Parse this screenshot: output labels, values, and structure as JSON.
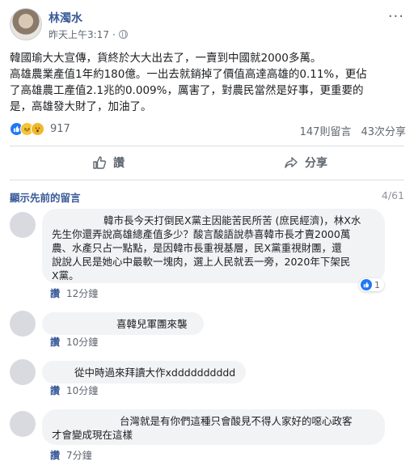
{
  "post": {
    "author": "林濁水",
    "time": "昨天上午3:17",
    "more_glyph": "···",
    "body_lines": [
      "韓國瑜大大宣傳，貨終於大大出去了，一賣到中國就2000多萬。",
      "高雄農業產值1年約180億。一出去就銷掉了價值高達高雄的0.11%，更佔",
      "了高雄農工產值2.1兆的0.009%，厲害了，對農民當然是好事，更重要的",
      "是，高雄發大財了，加油了。"
    ]
  },
  "reactions": {
    "count": "917",
    "comments": "147則留言",
    "shares": "43次分享",
    "icons": [
      "like-icon",
      "haha-icon",
      "wow-icon"
    ]
  },
  "actions": {
    "like": "讚",
    "share": "分享"
  },
  "comments_header": {
    "previous": "顯示先前的留言",
    "counter": "4/61"
  },
  "comments": [
    {
      "lines": [
        "韓市長今天打倒民X黨主因能苦民所苦 (庶民經濟)，林X水",
        "先生你還弄說高雄總產值多少？酸言酸語說恭喜韓市長才賣2000萬",
        "農、水產只占一點點，是因韓市長重視基層，民X黨重視財團，還",
        "說說人民是她心中最軟一塊肉，選上人民就丟一旁，2020年下架民",
        "X黨。"
      ],
      "like_label": "讚",
      "time": "12分鐘",
      "like_count": "1"
    },
    {
      "lines": [
        "喜韓兒軍團來襲"
      ],
      "like_label": "讚",
      "time": "10分鐘"
    },
    {
      "lines": [
        "從中時過來拜讀大作xdddddddddd"
      ],
      "like_label": "讚",
      "time": "10分鐘"
    },
    {
      "lines": [
        "台灣就是有你們這種只會酸見不得人家好的噁心政客",
        "才會變成現在這樣"
      ],
      "like_label": "讚",
      "time": "7分鐘"
    }
  ]
}
